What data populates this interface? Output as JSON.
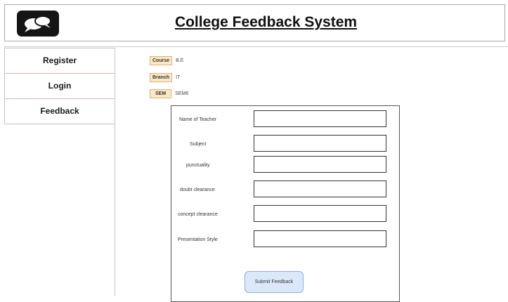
{
  "header": {
    "title": "College Feedback System",
    "logo_icon": "speech-bubbles-icon"
  },
  "sidebar": {
    "items": [
      {
        "label": "Register"
      },
      {
        "label": "Login"
      },
      {
        "label": "Feedback"
      }
    ]
  },
  "info": {
    "course": {
      "label": "Course",
      "value": "B.E"
    },
    "branch": {
      "label": "Branch",
      "value": "IT"
    },
    "sem": {
      "label": "SEM",
      "value": "SEM6"
    }
  },
  "form": {
    "fields": [
      {
        "label": "Name of Teacher",
        "value": ""
      },
      {
        "label": "Subject",
        "value": ""
      },
      {
        "label": "punctuality",
        "value": ""
      },
      {
        "label": "doubt clearance",
        "value": ""
      },
      {
        "label": "concept clearance",
        "value": ""
      },
      {
        "label": "Presentation Style",
        "value": ""
      }
    ],
    "submit_label": "Submit Feedback"
  },
  "colors": {
    "info_label_bg": "#fde8c4",
    "submit_bg": "#dbe8fa"
  }
}
